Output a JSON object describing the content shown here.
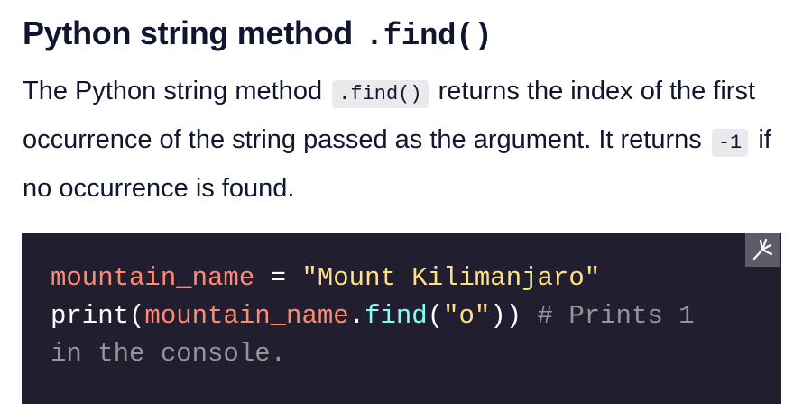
{
  "heading": {
    "text": "Python string method",
    "code": ".find()"
  },
  "description": {
    "part1": "The Python string method",
    "code1": ".find()",
    "part2": "returns the index of the first occurrence of the string passed as the argument. It returns",
    "code2": "-1",
    "part3": "if no occurrence is found."
  },
  "code_block": {
    "line1": {
      "var": "mountain_name",
      "op": " = ",
      "str": "\"Mount Kilimanjaro\""
    },
    "line2": {
      "fn_print": "print",
      "open": "(",
      "var": "mountain_name",
      "dot": ".",
      "fn_find": "find",
      "open2": "(",
      "str": "\"o\"",
      "close": "))",
      "comment": " # Prints 1 in the console."
    },
    "expand_button_icon": "expand-icon"
  },
  "colors": {
    "code_background": "#211e2f",
    "variable": "#ff8973",
    "string": "#ffe083",
    "function": "#83fff5",
    "comment": "#939598",
    "inline_code_background": "#eaeaec",
    "text": "#10162f"
  }
}
